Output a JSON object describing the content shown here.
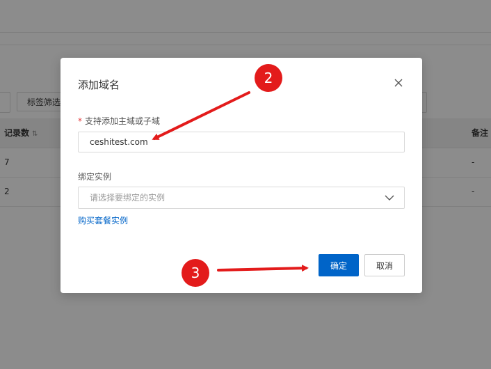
{
  "background": {
    "filter_button": "标签筛选",
    "table": {
      "headers": {
        "records": "记录数",
        "remarks": "备注"
      },
      "rows": [
        {
          "records": "7",
          "remarks": "-"
        },
        {
          "records": "2",
          "remarks": "-"
        }
      ]
    }
  },
  "modal": {
    "title": "添加域名",
    "domain_field": {
      "required_mark": "*",
      "label": "支持添加主域或子域",
      "value": "ceshitest.com"
    },
    "instance_field": {
      "label": "绑定实例",
      "placeholder": "请选择要绑定的实例"
    },
    "buy_link": "购买套餐实例",
    "confirm_button": "确定",
    "cancel_button": "取消"
  },
  "annotations": {
    "steps": [
      {
        "number": "2"
      },
      {
        "number": "3"
      }
    ],
    "arrow_color": "#e31b1b"
  },
  "colors": {
    "primary": "#0064c8",
    "link": "#0064c8",
    "required": "#e5393b",
    "annotation": "#e31b1b"
  }
}
